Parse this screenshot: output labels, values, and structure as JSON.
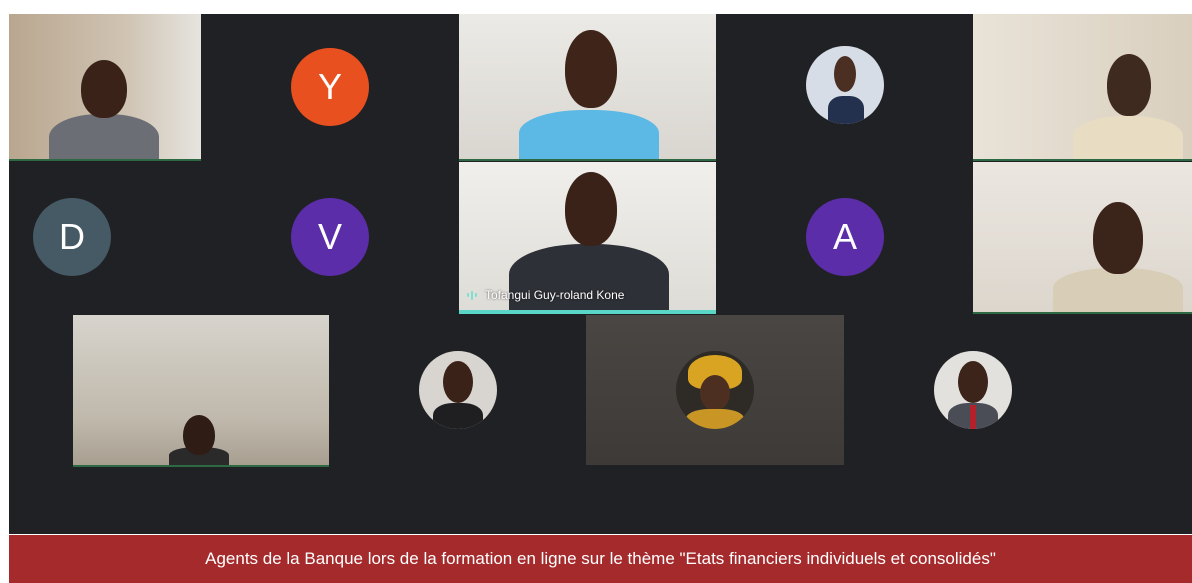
{
  "meeting": {
    "participants": [
      {
        "id": "p1",
        "type": "video"
      },
      {
        "id": "p2",
        "type": "initial",
        "initial": "Y",
        "color": "#e8501f"
      },
      {
        "id": "p3",
        "type": "video"
      },
      {
        "id": "p4",
        "type": "photo"
      },
      {
        "id": "p5",
        "type": "video"
      },
      {
        "id": "p6",
        "type": "initial",
        "initial": "D",
        "color": "#455a64"
      },
      {
        "id": "p7",
        "type": "initial",
        "initial": "V",
        "color": "#5b2da8"
      },
      {
        "id": "p8",
        "type": "video",
        "name": "Tofangui Guy-roland Kone",
        "speaking": true
      },
      {
        "id": "p9",
        "type": "initial",
        "initial": "A",
        "color": "#5b2da8"
      },
      {
        "id": "p10",
        "type": "video"
      },
      {
        "id": "p11",
        "type": "video"
      },
      {
        "id": "p12",
        "type": "photo"
      },
      {
        "id": "p13",
        "type": "photo"
      },
      {
        "id": "p14",
        "type": "photo"
      }
    ],
    "active_speaker_color": "#5ad6c6"
  },
  "caption": {
    "text": "Agents de la Banque lors de la formation en ligne sur le thème \"Etats financiers individuels et consolidés\"",
    "background": "#a52a2c"
  }
}
